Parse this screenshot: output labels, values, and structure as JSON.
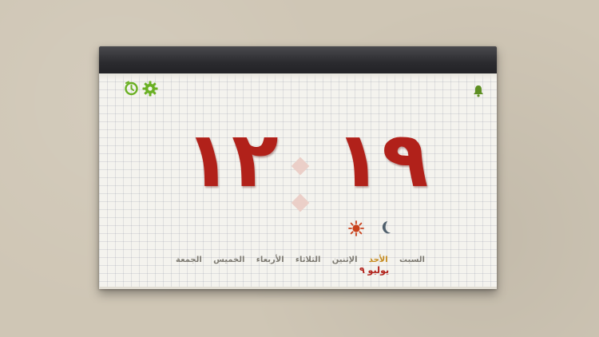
{
  "clock": {
    "hours": "١٩",
    "minutes": "١٢"
  },
  "weekdays": [
    {
      "label": "السبت",
      "active": false
    },
    {
      "label": "الأحد",
      "active": true
    },
    {
      "label": "الإثنين",
      "active": false
    },
    {
      "label": "الثلاثاء",
      "active": false
    },
    {
      "label": "الأربعاء",
      "active": false
    },
    {
      "label": "الخميس",
      "active": false
    },
    {
      "label": "الجمعة",
      "active": false
    }
  ],
  "date_text": "يوليو ٩",
  "icons": {
    "bell": "bell-icon",
    "settings": "gear-icon",
    "timer": "timer-icon",
    "night": "moon-icon",
    "day": "sun-icon"
  },
  "colors": {
    "digits": "#b1211a",
    "active_day": "#c58a1c",
    "weekday": "#7d7a72",
    "icon_green": "#6ab023",
    "moon": "#4f5f6c",
    "sun": "#c9411b"
  }
}
